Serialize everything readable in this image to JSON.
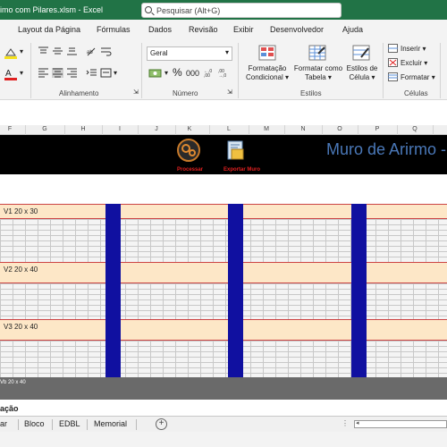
{
  "titlebar": {
    "filename": "imo com  Pilares.xlsm  -  Excel",
    "search_placeholder": "Pesquisar (Alt+G)"
  },
  "menu": [
    "Layout da Página",
    "Fórmulas",
    "Dados",
    "Revisão",
    "Exibir",
    "Desenvolvedor",
    "Ajuda"
  ],
  "ribbon": {
    "alinhamento_label": "Alinhamento",
    "numero_label": "Número",
    "estilos_label": "Estilos",
    "celulas_label": "Células",
    "number_format": "Geral",
    "percent": "%",
    "thousands": "000",
    "condicional_line1": "Formatação",
    "condicional_line2": "Condicional",
    "tabela_line1": "Formatar como",
    "tabela_line2": "Tabela",
    "estilos_line1": "Estilos de",
    "estilos_line2": "Célula",
    "inserir": "Inserir",
    "excluir": "Excluir",
    "formatar": "Formatar"
  },
  "columns": [
    "F",
    "G",
    "H",
    "I",
    "J",
    "K",
    "L",
    "M",
    "N",
    "O",
    "P",
    "Q"
  ],
  "banner": {
    "title": "Muro de Arirmo - P",
    "processar": "Processar",
    "exportar": "Exportar Muro"
  },
  "beams": [
    "V1 20 x 30",
    "V2 20 x 40",
    "V3 20 x 40"
  ],
  "foundation_label": "Vb 20 x 40",
  "bottom_heading": "ação",
  "tabs": [
    "ar",
    "Bloco",
    "EDBL",
    "Memorial"
  ],
  "colors": {
    "excel_green": "#217346",
    "pillar_blue": "#1010a0",
    "beam_fill": "#fde7c7",
    "title_blue": "#4a78b8"
  }
}
